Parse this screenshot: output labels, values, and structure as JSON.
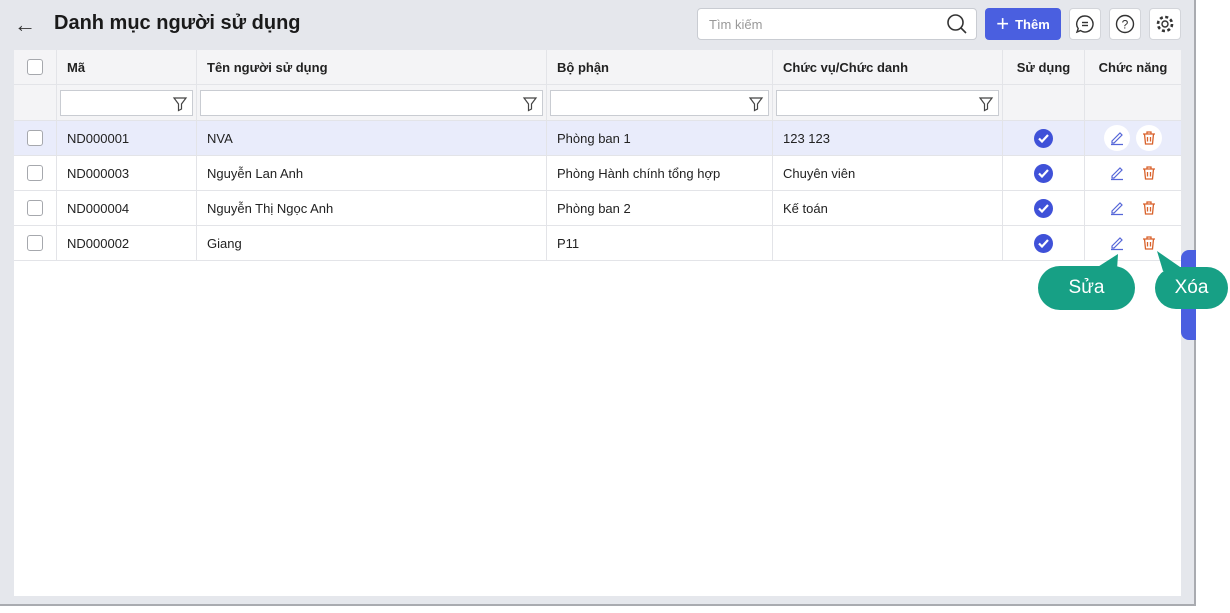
{
  "header": {
    "back_icon": "arrow-left-icon",
    "title": "Danh mục người sử dụng",
    "search_placeholder": "Tìm kiếm",
    "add_label": "Thêm"
  },
  "columns": [
    "Mã",
    "Tên người sử dụng",
    "Bộ phận",
    "Chức vụ/Chức danh",
    "Sử dụng",
    "Chức năng"
  ],
  "rows": [
    {
      "code": "ND000001",
      "name": "NVA",
      "dept": "Phòng ban 1",
      "position": "123 123",
      "active": true
    },
    {
      "code": "ND000003",
      "name": "Nguyễn Lan Anh",
      "dept": "Phòng Hành chính tổng hợp",
      "position": "Chuyên viên",
      "active": true
    },
    {
      "code": "ND000004",
      "name": "Nguyễn Thị Ngọc Anh",
      "dept": "Phòng ban 2",
      "position": "Kế toán",
      "active": true
    },
    {
      "code": "ND000002",
      "name": "Giang",
      "dept": "P11",
      "position": "",
      "active": true
    }
  ],
  "callouts": {
    "edit": "Sửa",
    "delete": "Xóa"
  },
  "colors": {
    "accent": "#4a5fe0",
    "callout": "#17a085",
    "delete": "#d9622b"
  }
}
